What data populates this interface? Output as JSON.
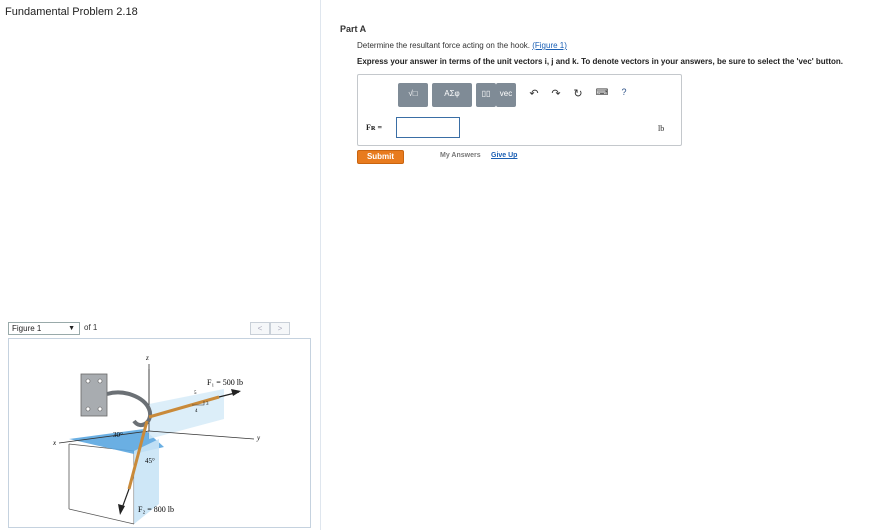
{
  "problem": {
    "title": "Fundamental Problem 2.18"
  },
  "figure_nav": {
    "selected": "Figure 1",
    "of_text": "of 1",
    "prev": "<",
    "next": ">"
  },
  "figure": {
    "f1_label": "F₁ = 500 lb",
    "f2_label": "F₂ = 800 lb",
    "angle_30": "30°",
    "angle_45": "45°",
    "tri_5": "5",
    "tri_4": "4",
    "tri_3": "3",
    "axis_x": "x",
    "axis_y": "y",
    "axis_z": "z",
    "colors": {
      "plane_blue": "#5aa6e0",
      "plane_light": "#c9e4f6",
      "wall": "#a8acb0",
      "rope": "#c98a3a"
    }
  },
  "part": {
    "label": "Part A",
    "question_text": "Determine the resultant force acting on the hook. ",
    "question_link": "(Figure 1)",
    "instruction": "Express your answer in terms of the unit vectors i, j and k. To denote vectors in your answers, be sure to select the 'vec' button.",
    "toolbar": {
      "templates": "√□",
      "greek": "ΑΣφ",
      "vec": "vec"
    },
    "answer_label": "Fʀ =",
    "answer_value": "",
    "unit": "lb",
    "submit": "Submit",
    "my_answers": "My Answers",
    "give_up": "Give Up"
  }
}
